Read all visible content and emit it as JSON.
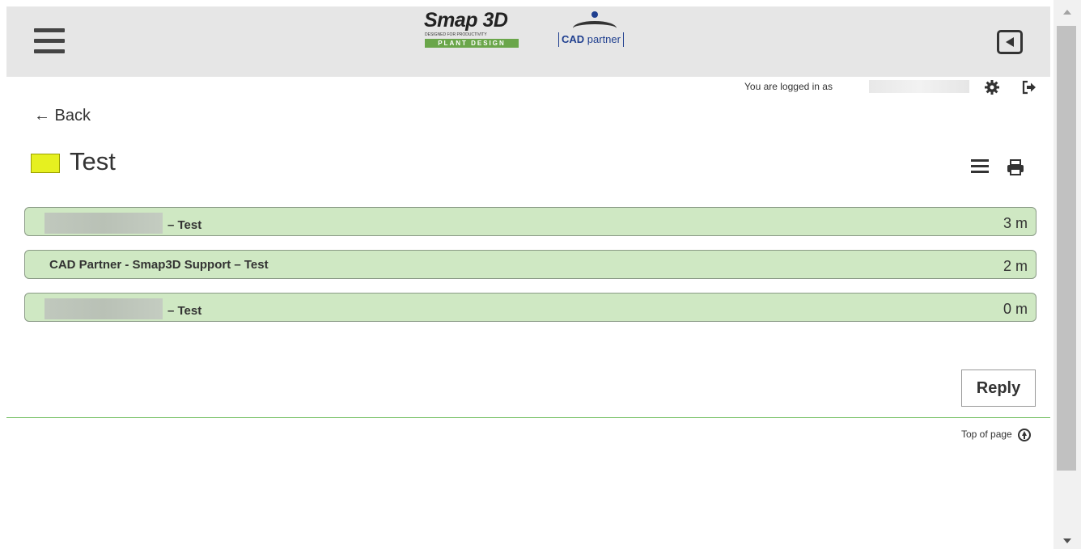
{
  "header": {
    "logo_smap": {
      "title": "Smap 3D",
      "tagline": "DESIGNED FOR PRODUCTIVITY",
      "bar": "PLANT DESIGN"
    },
    "logo_cad": {
      "cad": "CAD",
      "partner": " partner"
    }
  },
  "userbar": {
    "logged_in_text": "You are logged in as"
  },
  "nav": {
    "back_label": "← Back"
  },
  "thread": {
    "title": "Test",
    "color": "#e6f020"
  },
  "messages": [
    {
      "label": "– Test",
      "time": "3 m",
      "sender_redacted": true
    },
    {
      "label": "CAD Partner - Smap3D Support – Test",
      "time": "2 m",
      "sender_redacted": false
    },
    {
      "label": "– Test",
      "time": "0 m",
      "sender_redacted": true
    }
  ],
  "actions": {
    "reply_label": "Reply"
  },
  "footer": {
    "top_of_page": "Top of page"
  },
  "colors": {
    "header_bg": "#e6e6e6",
    "row_bg": "#cfe8c3",
    "divider": "#7bc36a",
    "brand_green": "#6aa64a",
    "brand_blue": "#1f3f8f"
  }
}
